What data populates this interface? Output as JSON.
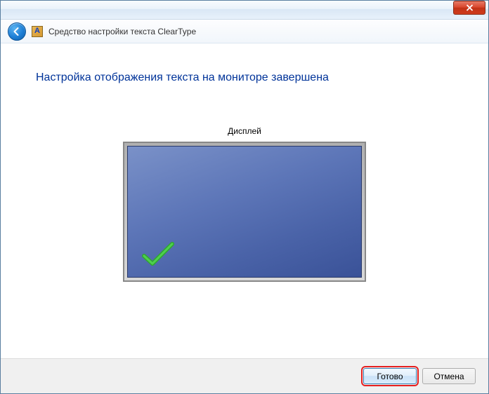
{
  "window": {
    "app_title": "Средство настройки текста ClearType",
    "app_icon_letter": "A"
  },
  "content": {
    "heading": "Настройка отображения текста на мониторе завершена",
    "display_label": "Дисплей"
  },
  "footer": {
    "done_label": "Готово",
    "cancel_label": "Отмена"
  }
}
